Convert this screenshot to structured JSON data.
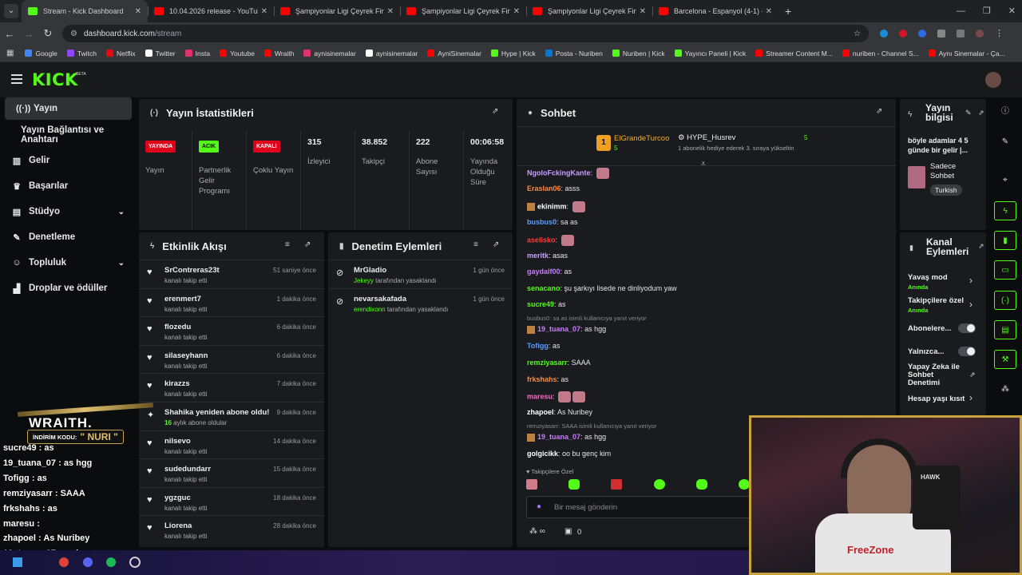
{
  "browser": {
    "tabs": [
      {
        "title": "Stream - Kick Dashboard",
        "active": true,
        "color": "#53fc18"
      },
      {
        "title": "10.04.2026 release - YouTube",
        "color": "#ff0000"
      },
      {
        "title": "Şampiyonlar Ligi Çeyrek Final |",
        "color": "#ff0000"
      },
      {
        "title": "Şampiyonlar Ligi Çeyrek Final |",
        "color": "#ff0000"
      },
      {
        "title": "Şampiyonlar Ligi Çeyrek Final |",
        "color": "#ff0000"
      },
      {
        "title": "Barcelona - Espanyol (4-1) - Ma",
        "color": "#ff0000"
      }
    ],
    "url_domain": "dashboard.kick.com",
    "url_path": "/stream",
    "bookmarks": [
      {
        "label": "Google",
        "color": "#4285f4"
      },
      {
        "label": "Twitch",
        "color": "#9146ff"
      },
      {
        "label": "Netflix",
        "color": "#e50914"
      },
      {
        "label": "Twitter",
        "color": "#ffffff"
      },
      {
        "label": "Insta",
        "color": "#e1306c"
      },
      {
        "label": "Youtube",
        "color": "#ff0000"
      },
      {
        "label": "Wraith",
        "color": "#ff0000"
      },
      {
        "label": "aynisinemalar",
        "color": "#e1306c"
      },
      {
        "label": "aynisinemalar",
        "color": "#ffffff"
      },
      {
        "label": "AyniSinemalar",
        "color": "#ff0000"
      },
      {
        "label": "Hype | Kick",
        "color": "#53fc18"
      },
      {
        "label": "Posta - Nuriben",
        "color": "#0078d4"
      },
      {
        "label": "Nuriben | Kick",
        "color": "#53fc18"
      },
      {
        "label": "Yayıncı Paneli | Kick",
        "color": "#53fc18"
      },
      {
        "label": "Streamer Content M...",
        "color": "#ff0000"
      },
      {
        "label": "nuriben - Channel S...",
        "color": "#ff0000"
      },
      {
        "label": "Aynı Sinemalar - Ça...",
        "color": "#ff0000"
      }
    ]
  },
  "header": {
    "logo": "KICK",
    "beta": "BETA"
  },
  "sidebar": {
    "items": [
      {
        "label": "Yayın",
        "icon": "broadcast-icon"
      },
      {
        "label": "Yayın Bağlantısı ve Anahtarı",
        "icon": ""
      },
      {
        "label": "Gelir",
        "icon": "revenue-icon"
      },
      {
        "label": "Başarılar",
        "icon": "trophy-icon"
      },
      {
        "label": "Stüdyo",
        "icon": "studio-icon"
      },
      {
        "label": "Denetleme",
        "icon": "wrench-icon"
      },
      {
        "label": "Topluluk",
        "icon": "community-icon"
      },
      {
        "label": "Droplar ve ödüller",
        "icon": "drops-icon"
      }
    ]
  },
  "stats": {
    "title": "Yayın İstatistikleri",
    "cells": [
      {
        "badge": "YAYINDA",
        "label": "Yayın",
        "badge_color": "#e0001a"
      },
      {
        "badge": "ACIK",
        "label": "Partnerlik Gelir Programı",
        "badge_color": "#53fc18"
      },
      {
        "badge": "KAPALI",
        "label": "Çoklu Yayın",
        "badge_color": "#e0001a"
      },
      {
        "value": "315",
        "label": "İzleyici"
      },
      {
        "value": "38.852",
        "label": "Takipçi"
      },
      {
        "value": "222",
        "label": "Abone Sayısı"
      },
      {
        "value": "00:06:58",
        "label": "Yayında Olduğu Süre"
      }
    ]
  },
  "activity": {
    "title": "Etkinlik Akışı",
    "rows": [
      {
        "name": "SrContreras23t",
        "sub": "kanalı takip etti",
        "time": "51 saniye önce"
      },
      {
        "name": "erenmert7",
        "sub": "kanalı takip etti",
        "time": "1 dakika önce"
      },
      {
        "name": "flozedu",
        "sub": "kanalı takip etti",
        "time": "6 dakika önce"
      },
      {
        "name": "silaseyhann",
        "sub": "kanalı takip etti",
        "time": "6 dakika önce"
      },
      {
        "name": "kirazzs",
        "sub": "kanalı takip etti",
        "time": "7 dakika önce"
      },
      {
        "name": "Shahika yeniden abone oldu!",
        "sub_count": "16",
        "sub": "aylık abone oldular",
        "time": "9 dakika önce"
      },
      {
        "name": "nilsevo",
        "sub": "kanalı takip etti",
        "time": "14 dakika önce"
      },
      {
        "name": "sudedundarr",
        "sub": "kanalı takip etti",
        "time": "15 dakika önce"
      },
      {
        "name": "ygzguc",
        "sub": "kanalı takip etti",
        "time": "18 dakika önce"
      },
      {
        "name": "Liorena",
        "sub": "kanalı takip etti",
        "time": "28 dakika önce"
      }
    ]
  },
  "moderation": {
    "title": "Denetim Eylemleri",
    "rows": [
      {
        "name": "MrGladio",
        "by": "Jekeyy",
        "sub": "tarafından yasaklandı",
        "time": "1 gün önce"
      },
      {
        "name": "nevarsakafada",
        "by": "erendixonn",
        "sub": "tarafından yasaklandı",
        "time": "1 gün önce"
      }
    ]
  },
  "chat": {
    "title": "Sohbet",
    "top_user": "ElGrandeTurcoo",
    "top_count": "5",
    "top_rank": "1",
    "hype_user": "HYPE_Husrev",
    "hype_count": "5",
    "hype_text": "1 abonelik hediye ederek 3. sıraya yükseltin",
    "messages": [
      {
        "user": "NgoloFckingKante",
        "text": "",
        "color": "#c7a0ff"
      },
      {
        "user": "Eraslan06",
        "text": "asss",
        "color": "#ff8a3d"
      },
      {
        "user": "ekinimm",
        "text": "",
        "color": "#ffffff"
      },
      {
        "user": "busbus0",
        "text": "sa as",
        "color": "#5b9dff"
      },
      {
        "user": "aselisko",
        "text": "",
        "color": "#ff3b3b"
      },
      {
        "user": "meritk",
        "text": "asas",
        "color": "#c7a0ff"
      },
      {
        "user": "gaydalf00",
        "text": "as",
        "color": "#c77dff"
      },
      {
        "user": "senacano",
        "text": "şu şarkıyı lisede ne dinliyodum yaw",
        "color": "#53fc18"
      },
      {
        "user": "sucre49",
        "text": "as",
        "color": "#53fc18"
      },
      {
        "user": "19_tuana_07",
        "text": "as hgg",
        "color": "#c77dff"
      },
      {
        "user": "Tofigg",
        "text": "as",
        "color": "#5b9dff"
      },
      {
        "user": "remziyasarr",
        "text": "SAAA",
        "color": "#53fc18"
      },
      {
        "user": "frkshahs",
        "text": "as",
        "color": "#ff8a3d"
      },
      {
        "user": "maresu",
        "text": "",
        "color": "#ff66c4"
      },
      {
        "user": "zhapoel",
        "text": "As Nuribey",
        "color": "#ffffff"
      },
      {
        "user": "19_tuana_07",
        "text": "as hgg",
        "color": "#c77dff"
      },
      {
        "user": "golgicikk",
        "text": "oo bu genç kim",
        "color": "#ffffff"
      }
    ],
    "reply1": "busbus0: sa as isimli kullanıcıya yanıt veriyor",
    "reply2": "remziyasarr: SAAA isimli kullanıcıya yanıt veriyor",
    "followers_only": "Takipçilere Özel",
    "input_placeholder": "Bir mesaj gönderin",
    "bottom_count": "0"
  },
  "stream_info": {
    "title": "Yayın bilgisi",
    "stream_title": "böyle adamlar 4 5 günde bir gelir |...",
    "category": "Sadece Sohbet",
    "language": "Turkish"
  },
  "channel_actions": {
    "title": "Kanal Eylemleri",
    "items": [
      {
        "label": "Yavaş mod",
        "sub": "Anında"
      },
      {
        "label": "Takipçilere özel",
        "sub": "Anında"
      },
      {
        "label": "Abonelere...",
        "sub": ""
      },
      {
        "label": "Yalnızca...",
        "sub": ""
      },
      {
        "label": "Yapay Zeka ile Sohbet Denetimi",
        "sub": ""
      },
      {
        "label": "Hesap yaşı kısıt",
        "sub": ""
      }
    ]
  },
  "overlay": {
    "sponsor": "WRAITH.",
    "code_label": "İNDİRİM KODU:",
    "code": "\" NURI \"",
    "lines": [
      {
        "user": "sucre49",
        "text": "as"
      },
      {
        "user": "19_tuana_07",
        "text": "as hgg"
      },
      {
        "user": "Tofigg",
        "text": "as"
      },
      {
        "user": "remziyasarr",
        "text": "SAAA"
      },
      {
        "user": "frkshahs",
        "text": "as"
      },
      {
        "user": "maresu",
        "text": ""
      },
      {
        "user": "zhapoel",
        "text": "As Nuribey"
      },
      {
        "user": "19_tuana_07",
        "text": "as hgg"
      },
      {
        "user": "golgicikk",
        "text": "oo bu genç kim"
      }
    ],
    "jersey": "FreeZone",
    "headset": "HAWK"
  }
}
